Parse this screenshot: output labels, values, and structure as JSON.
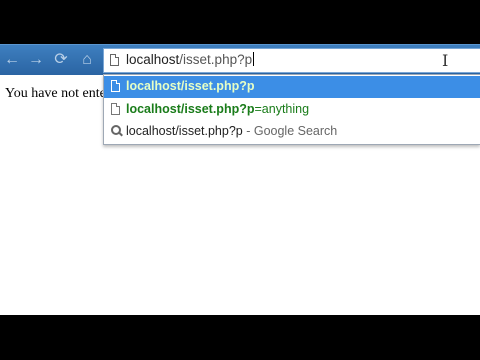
{
  "omnibox": {
    "host": "localhost",
    "path": "/isset.php?p"
  },
  "page": {
    "visible_text": "You have not enter"
  },
  "suggestions": [
    {
      "bold": "localhost/isset.php?p",
      "tail": ""
    },
    {
      "bold": "localhost/isset.php?p",
      "tail": "=anything"
    },
    {
      "query": "localhost/isset.php?p",
      "source": " - Google Search"
    }
  ],
  "colors": {
    "toolbar": "#2f6dad",
    "selected_row": "#3c8ee6",
    "url_match_green": "#1a7c1a"
  },
  "icons": [
    "back-arrow-icon",
    "forward-arrow-icon",
    "reload-icon",
    "home-icon",
    "page-icon",
    "search-icon",
    "text-cursor-icon"
  ]
}
